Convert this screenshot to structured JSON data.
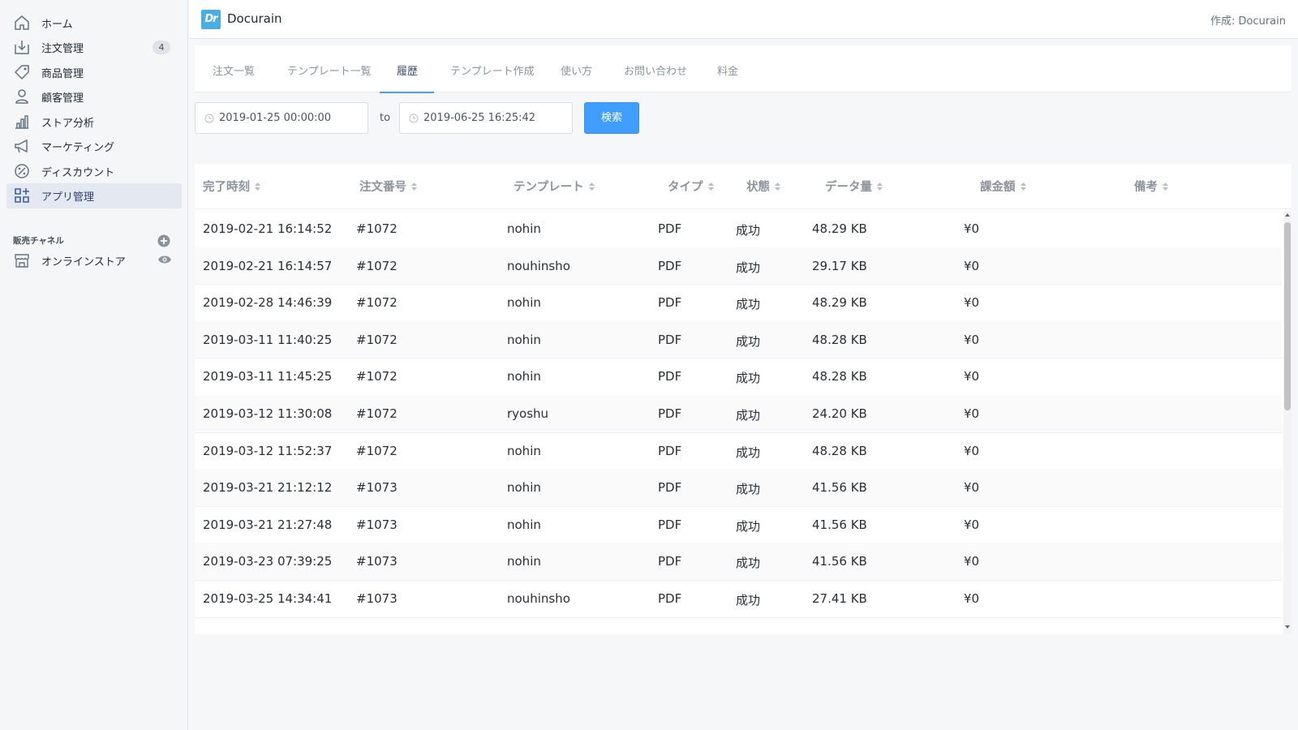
{
  "sidebar": {
    "nav": [
      {
        "label": "ホーム",
        "icon": "home-icon"
      },
      {
        "label": "注文管理",
        "icon": "orders-icon",
        "badge": "4"
      },
      {
        "label": "商品管理",
        "icon": "tag-icon"
      },
      {
        "label": "顧客管理",
        "icon": "user-icon"
      },
      {
        "label": "ストア分析",
        "icon": "bar-chart-icon"
      },
      {
        "label": "マーケティング",
        "icon": "megaphone-icon"
      },
      {
        "label": "ディスカウント",
        "icon": "discount-icon"
      },
      {
        "label": "アプリ管理",
        "icon": "apps-icon",
        "active": true
      }
    ],
    "channels_title": "販売チャネル",
    "channels": [
      {
        "label": "オンラインストア",
        "icon": "store-icon"
      }
    ]
  },
  "topbar": {
    "logo_text": "Dr",
    "app_title": "Docurain",
    "author": "作成: Docurain"
  },
  "tabs": [
    "注文一覧",
    "テンプレート一覧",
    "履歴",
    "テンプレート作成",
    "使い方",
    "お問い合わせ",
    "料金"
  ],
  "active_tab": "履歴",
  "filters": {
    "from": "2019-01-25 00:00:00",
    "to_label": "to",
    "to": "2019-06-25 16:25:42",
    "search_label": "検索"
  },
  "table": {
    "columns": [
      "完了時刻",
      "注文番号",
      "テンプレート",
      "タイプ",
      "状態",
      "データ量",
      "課金額",
      "備考"
    ],
    "rows": [
      [
        "2019-02-21 16:14:52",
        "#1072",
        "nohin",
        "PDF",
        "成功",
        "48.29 KB",
        "¥0",
        ""
      ],
      [
        "2019-02-21 16:14:57",
        "#1072",
        "nouhinsho",
        "PDF",
        "成功",
        "29.17 KB",
        "¥0",
        ""
      ],
      [
        "2019-02-28 14:46:39",
        "#1072",
        "nohin",
        "PDF",
        "成功",
        "48.29 KB",
        "¥0",
        ""
      ],
      [
        "2019-03-11 11:40:25",
        "#1072",
        "nohin",
        "PDF",
        "成功",
        "48.28 KB",
        "¥0",
        ""
      ],
      [
        "2019-03-11 11:45:25",
        "#1072",
        "nohin",
        "PDF",
        "成功",
        "48.28 KB",
        "¥0",
        ""
      ],
      [
        "2019-03-12 11:30:08",
        "#1072",
        "ryoshu",
        "PDF",
        "成功",
        "24.20 KB",
        "¥0",
        ""
      ],
      [
        "2019-03-12 11:52:37",
        "#1072",
        "nohin",
        "PDF",
        "成功",
        "48.28 KB",
        "¥0",
        ""
      ],
      [
        "2019-03-21 21:12:12",
        "#1073",
        "nohin",
        "PDF",
        "成功",
        "41.56 KB",
        "¥0",
        ""
      ],
      [
        "2019-03-21 21:27:48",
        "#1073",
        "nohin",
        "PDF",
        "成功",
        "41.56 KB",
        "¥0",
        ""
      ],
      [
        "2019-03-23 07:39:25",
        "#1073",
        "nohin",
        "PDF",
        "成功",
        "41.56 KB",
        "¥0",
        ""
      ],
      [
        "2019-03-25 14:34:41",
        "#1073",
        "nouhinsho",
        "PDF",
        "成功",
        "27.41 KB",
        "¥0",
        ""
      ]
    ]
  },
  "colors": {
    "accent": "#409eff",
    "logo": "#4aaee3",
    "sidebar_active": "#e4e8f0"
  }
}
